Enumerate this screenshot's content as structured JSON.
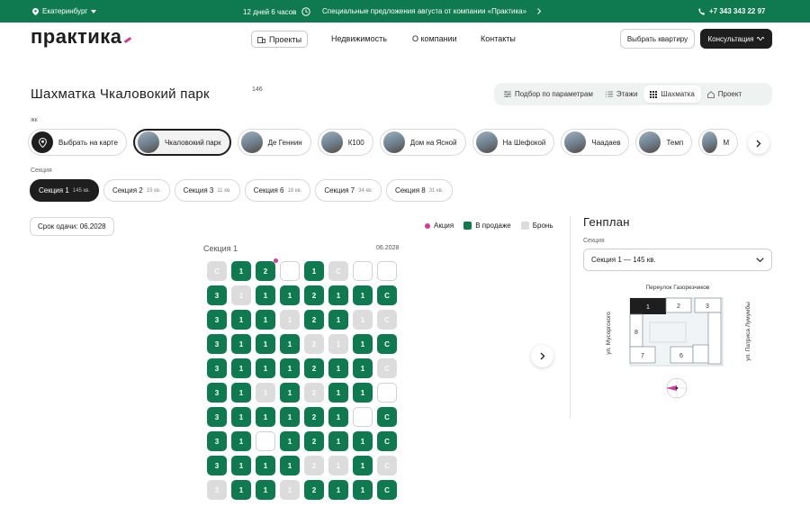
{
  "topbar": {
    "city": "Екатеринбург",
    "timer": "12 дней 6 часов",
    "promo": "Специальные предложения августа от компании «Практика»",
    "phone": "+7 343 343 22 97"
  },
  "header": {
    "logo": "практика",
    "nav": [
      "Проекты",
      "Недвижимость",
      "О компании",
      "Контакты"
    ],
    "choose_button": "Выбрать квартиру",
    "consult_button": "Консультация"
  },
  "page": {
    "title": "Шахматка Чкаловокий парк",
    "count": "146"
  },
  "view_tabs": [
    "Подбор по параметрам",
    "Этажи",
    "Шахматка",
    "Проект"
  ],
  "projects": {
    "label": "жк",
    "items": [
      "Выбрать на карте",
      "Чкаловокий парк",
      "Де Геннин",
      "К100",
      "Дом на Ясной",
      "На Шефокой",
      "Чаадаев",
      "Темп",
      "М"
    ]
  },
  "sections": {
    "label": "Секция",
    "items": [
      {
        "name": "Секция 1",
        "count": "145 кв."
      },
      {
        "name": "Секция 2",
        "count": "15 кв."
      },
      {
        "name": "Секция 3",
        "count": "11 кв."
      },
      {
        "name": "Секция 6",
        "count": "18 кв."
      },
      {
        "name": "Секция 7",
        "count": "34 кв."
      },
      {
        "name": "Секция 8",
        "count": "31 кв."
      }
    ]
  },
  "deadline": "Срок одачи: 06.2028",
  "legend": {
    "promo": "Акция",
    "sale": "В продаже",
    "reserved": "Бронь",
    "colors": {
      "promo": "#d13b9a",
      "sale": "#0f7a4f",
      "reserved": "#dcdcdc"
    }
  },
  "grid": {
    "title": "Секция 1",
    "date": "06.2028",
    "rows": [
      [
        {
          "v": "С",
          "s": "res"
        },
        {
          "v": "1",
          "s": "sale"
        },
        {
          "v": "2",
          "s": "sale",
          "promo": true
        },
        {
          "v": "",
          "s": "empty"
        },
        {
          "v": "1",
          "s": "sale"
        },
        {
          "v": "С",
          "s": "res"
        },
        {
          "v": "",
          "s": "empty"
        },
        {
          "v": "",
          "s": "empty"
        }
      ],
      [
        {
          "v": "3",
          "s": "sale"
        },
        {
          "v": "1",
          "s": "res"
        },
        {
          "v": "1",
          "s": "sale"
        },
        {
          "v": "1",
          "s": "sale"
        },
        {
          "v": "2",
          "s": "sale"
        },
        {
          "v": "1",
          "s": "sale"
        },
        {
          "v": "1",
          "s": "sale"
        },
        {
          "v": "С",
          "s": "sale"
        }
      ],
      [
        {
          "v": "3",
          "s": "sale"
        },
        {
          "v": "1",
          "s": "sale"
        },
        {
          "v": "1",
          "s": "sale"
        },
        {
          "v": "1",
          "s": "res"
        },
        {
          "v": "2",
          "s": "sale"
        },
        {
          "v": "1",
          "s": "sale"
        },
        {
          "v": "1",
          "s": "res"
        },
        {
          "v": "С",
          "s": "res"
        }
      ],
      [
        {
          "v": "3",
          "s": "sale"
        },
        {
          "v": "1",
          "s": "sale"
        },
        {
          "v": "1",
          "s": "sale"
        },
        {
          "v": "1",
          "s": "sale"
        },
        {
          "v": "2",
          "s": "res"
        },
        {
          "v": "1",
          "s": "res"
        },
        {
          "v": "1",
          "s": "sale"
        },
        {
          "v": "С",
          "s": "sale"
        }
      ],
      [
        {
          "v": "3",
          "s": "sale"
        },
        {
          "v": "1",
          "s": "sale"
        },
        {
          "v": "1",
          "s": "sale"
        },
        {
          "v": "1",
          "s": "sale"
        },
        {
          "v": "2",
          "s": "sale"
        },
        {
          "v": "1",
          "s": "sale"
        },
        {
          "v": "1",
          "s": "sale"
        },
        {
          "v": "С",
          "s": "res"
        }
      ],
      [
        {
          "v": "3",
          "s": "sale"
        },
        {
          "v": "1",
          "s": "sale"
        },
        {
          "v": "1",
          "s": "res"
        },
        {
          "v": "1",
          "s": "sale"
        },
        {
          "v": "2",
          "s": "res"
        },
        {
          "v": "1",
          "s": "sale"
        },
        {
          "v": "1",
          "s": "sale"
        },
        {
          "v": "",
          "s": "empty"
        }
      ],
      [
        {
          "v": "3",
          "s": "sale"
        },
        {
          "v": "1",
          "s": "sale"
        },
        {
          "v": "1",
          "s": "sale"
        },
        {
          "v": "1",
          "s": "sale"
        },
        {
          "v": "2",
          "s": "sale"
        },
        {
          "v": "1",
          "s": "sale"
        },
        {
          "v": "",
          "s": "empty"
        },
        {
          "v": "С",
          "s": "sale"
        }
      ],
      [
        {
          "v": "3",
          "s": "sale"
        },
        {
          "v": "1",
          "s": "sale"
        },
        {
          "v": "",
          "s": "empty"
        },
        {
          "v": "1",
          "s": "sale"
        },
        {
          "v": "2",
          "s": "sale"
        },
        {
          "v": "1",
          "s": "sale"
        },
        {
          "v": "1",
          "s": "sale"
        },
        {
          "v": "С",
          "s": "sale"
        }
      ],
      [
        {
          "v": "3",
          "s": "sale"
        },
        {
          "v": "1",
          "s": "sale"
        },
        {
          "v": "1",
          "s": "sale"
        },
        {
          "v": "1",
          "s": "sale"
        },
        {
          "v": "2",
          "s": "res"
        },
        {
          "v": "1",
          "s": "res"
        },
        {
          "v": "1",
          "s": "sale"
        },
        {
          "v": "С",
          "s": "res"
        }
      ],
      [
        {
          "v": "3",
          "s": "res"
        },
        {
          "v": "1",
          "s": "sale"
        },
        {
          "v": "1",
          "s": "sale"
        },
        {
          "v": "1",
          "s": "res"
        },
        {
          "v": "2",
          "s": "sale"
        },
        {
          "v": "1",
          "s": "sale"
        },
        {
          "v": "1",
          "s": "sale"
        },
        {
          "v": "С",
          "s": "sale"
        }
      ]
    ]
  },
  "genplan": {
    "title": "Генплан",
    "section_label": "Секция",
    "selected": "Секция 1 — 145 кв.",
    "street_top": "Переулок Газорезчиков",
    "street_left": "ул. Мусоргского",
    "street_right": "ул. Патриса Лумумбы",
    "buildings": [
      "1",
      "2",
      "3",
      "6",
      "7",
      "8"
    ]
  }
}
